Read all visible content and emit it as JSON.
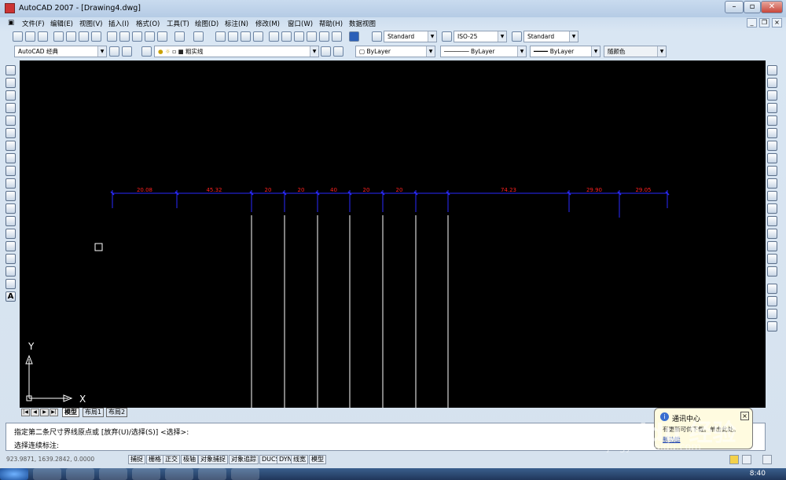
{
  "window": {
    "title": "AutoCAD 2007 - [Drawing4.dwg]"
  },
  "menu": [
    "文件(F)",
    "编辑(E)",
    "视图(V)",
    "插入(I)",
    "格式(O)",
    "工具(T)",
    "绘图(D)",
    "标注(N)",
    "修改(M)",
    "窗口(W)",
    "帮助(H)",
    "数据视图"
  ],
  "toolbar": {
    "text_style": "Standard",
    "dim_style": "ISO-25",
    "table_style": "Standard",
    "workspace": "AutoCAD 经典",
    "layer": "粗实线",
    "color": "ByLayer",
    "linetype": "ByLayer",
    "lineweight": "ByLayer",
    "plotstyle": "随颜色"
  },
  "dimensions": [
    "20.08",
    "45.32",
    "20",
    "20",
    "40",
    "20",
    "20",
    "74.23",
    "29.90",
    "29.05"
  ],
  "tabs": [
    "模型",
    "布局1",
    "布局2"
  ],
  "command": {
    "line1": "指定第二条尺寸界线原点或 [放弃(U)/选择(S)] <选择>:",
    "line2": "选择连续标注:"
  },
  "status": {
    "coords": "923.9871,  1639.2842, 0.0000",
    "buttons": [
      "捕捉",
      "栅格",
      "正交",
      "极轴",
      "对象捕捉",
      "对象追踪",
      "DUCS",
      "DYN",
      "线宽",
      "模型"
    ]
  },
  "balloon": {
    "title": "通讯中心",
    "body": "有更新可供下载。单击此处。",
    "link": "新功能"
  },
  "watermark": {
    "text": "Baidu 经验",
    "url": "jingyan.baidu.com"
  },
  "ucs": {
    "x": "X",
    "y": "Y"
  },
  "clock": "8:40",
  "colors": {
    "canvas": "#000000",
    "dim_line": "#2a2aff",
    "dim_text": "#ff2020",
    "ext_line": "#ffffff"
  }
}
